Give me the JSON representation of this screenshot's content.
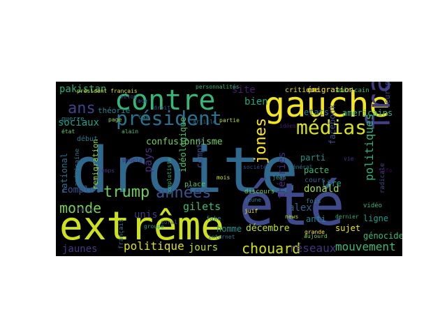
{
  "wordcloud": {
    "background": "#000000",
    "words": [
      {
        "text": "droite",
        "color": "#31688e"
      },
      {
        "text": "été",
        "color": "#3e4a89"
      },
      {
        "text": "extrême",
        "color": "#cde11d"
      },
      {
        "text": "gauche",
        "color": "#f4e61e"
      },
      {
        "text": "contre",
        "color": "#35b779"
      },
      {
        "text": "france",
        "color": "#433e85"
      },
      {
        "text": "président",
        "color": "#2c728e"
      },
      {
        "text": "médias",
        "color": "#d8e219"
      },
      {
        "text": "trump",
        "color": "#6ccd5a"
      },
      {
        "text": "années",
        "color": "#3b528b"
      },
      {
        "text": "monde",
        "color": "#75d054"
      },
      {
        "text": "chouard",
        "color": "#d0e11c"
      },
      {
        "text": "jones",
        "color": "#fde725"
      },
      {
        "text": "ans",
        "color": "#404387"
      },
      {
        "text": "politiques",
        "color": "#2db27d"
      },
      {
        "text": "mouvement",
        "color": "#3aba76"
      },
      {
        "text": "réseaux",
        "color": "#46337f"
      },
      {
        "text": "politique",
        "color": "#dde318"
      },
      {
        "text": "jaunes",
        "color": "#443983"
      },
      {
        "text": "gilets",
        "color": "#3dbc74"
      },
      {
        "text": "pakistan",
        "color": "#26ad81"
      },
      {
        "text": "sociaux",
        "color": "#1fa187"
      },
      {
        "text": "confusionnisme",
        "color": "#73d056"
      },
      {
        "text": "pays",
        "color": "#46307e"
      },
      {
        "text": "unis",
        "color": "#453882"
      },
      {
        "text": "jours",
        "color": "#bade28"
      },
      {
        "text": "donald",
        "color": "#a2da37"
      },
      {
        "text": "décembre",
        "color": "#c2df23"
      },
      {
        "text": "théories",
        "color": "#472a7a"
      },
      {
        "text": "site",
        "color": "#481c6e"
      },
      {
        "text": "bien",
        "color": "#22a785"
      },
      {
        "text": "parti",
        "color": "#21918c"
      },
      {
        "text": "pacte",
        "color": "#38b977"
      },
      {
        "text": "alex",
        "color": "#34618d"
      },
      {
        "text": "national",
        "color": "#2c718e"
      },
      {
        "text": "complot",
        "color": "#3a548c"
      },
      {
        "text": "compte",
        "color": "#3e4c8a"
      },
      {
        "text": "homme",
        "color": "#20928c"
      },
      {
        "text": "facebook",
        "color": "#3d4e8a"
      },
      {
        "text": "etats",
        "color": "#2a788e"
      },
      {
        "text": "americains",
        "color": "#2fb47c"
      },
      {
        "text": "idéologique",
        "color": "#4ac16d"
      },
      {
        "text": "lire",
        "color": "#1f9e89"
      },
      {
        "text": "ligne",
        "color": "#1e9c89"
      },
      {
        "text": "sujet",
        "color": "#f1e51d"
      },
      {
        "text": "anti",
        "color": "#26828e"
      },
      {
        "text": "génocide",
        "color": "#3bbb75"
      },
      {
        "text": "remigration",
        "color": "#9bd93c"
      },
      {
        "text": "début",
        "color": "#287c8e"
      },
      {
        "text": "théorie",
        "color": "#25848e"
      },
      {
        "text": "place",
        "color": "#5cc863"
      },
      {
        "text": "cours",
        "color": "#375b8d"
      },
      {
        "text": "europe",
        "color": "#3f4889"
      },
      {
        "text": "fois",
        "color": "#297b8e"
      },
      {
        "text": "américain",
        "color": "#35b779"
      },
      {
        "text": "critique",
        "color": "#e5e419"
      },
      {
        "text": "émigration",
        "color": "#fde725"
      },
      {
        "text": "américaine",
        "color": "#2a788e"
      },
      {
        "text": "français",
        "color": "#31688e"
      },
      {
        "text": "vidéo",
        "color": "#2fb47c"
      },
      {
        "text": "radicale",
        "color": "#3e4a89"
      },
      {
        "text": "guerre",
        "color": "#25848e"
      },
      {
        "text": "discours",
        "color": "#6ccd5a"
      },
      {
        "text": "idées",
        "color": "#481a6c"
      },
      {
        "text": "complotiste",
        "color": "#2db27d"
      },
      {
        "text": "page",
        "color": "#8fd744"
      },
      {
        "text": "face",
        "color": "#365c8d"
      },
      {
        "text": "fake",
        "color": "#23898e"
      },
      {
        "text": "news",
        "color": "#b8de29"
      },
      {
        "text": "internet",
        "color": "#2c728e"
      },
      {
        "text": "grande",
        "color": "#fde725"
      },
      {
        "text": "aujourd",
        "color": "#75d054"
      },
      {
        "text": "selon",
        "color": "#414487"
      },
      {
        "text": "droit",
        "color": "#3b528b"
      },
      {
        "text": "jeune",
        "color": "#2a788e"
      },
      {
        "text": "faire",
        "color": "#481f70"
      },
      {
        "text": "cas",
        "color": "#1f988b"
      },
      {
        "text": "mois",
        "color": "#d2e21b"
      },
      {
        "text": "juif",
        "color": "#fde725"
      },
      {
        "text": "général",
        "color": "#2a788e"
      },
      {
        "text": "info",
        "color": "#440154"
      },
      {
        "text": "temps",
        "color": "#46327e"
      },
      {
        "text": "article",
        "color": "#2e6e8e"
      },
      {
        "text": "alain",
        "color": "#4ac16d"
      },
      {
        "text": "vie",
        "color": "#453581"
      },
      {
        "text": "soral",
        "color": "#3b528b"
      },
      {
        "text": "partie",
        "color": "#b5de2b"
      },
      {
        "text": "groupe",
        "color": "#1fa088"
      },
      {
        "text": "état",
        "color": "#6ece58"
      },
      {
        "text": "société",
        "color": "#3e4989"
      },
      {
        "text": "jean",
        "color": "#1f9f88"
      },
      {
        "text": "peuple",
        "color": "#472c7a"
      },
      {
        "text": "personnalités",
        "color": "#31b57b"
      },
      {
        "text": "dernier",
        "color": "#2db27d"
      },
      {
        "text": "président français",
        "color": "#d5e21a"
      }
    ]
  }
}
